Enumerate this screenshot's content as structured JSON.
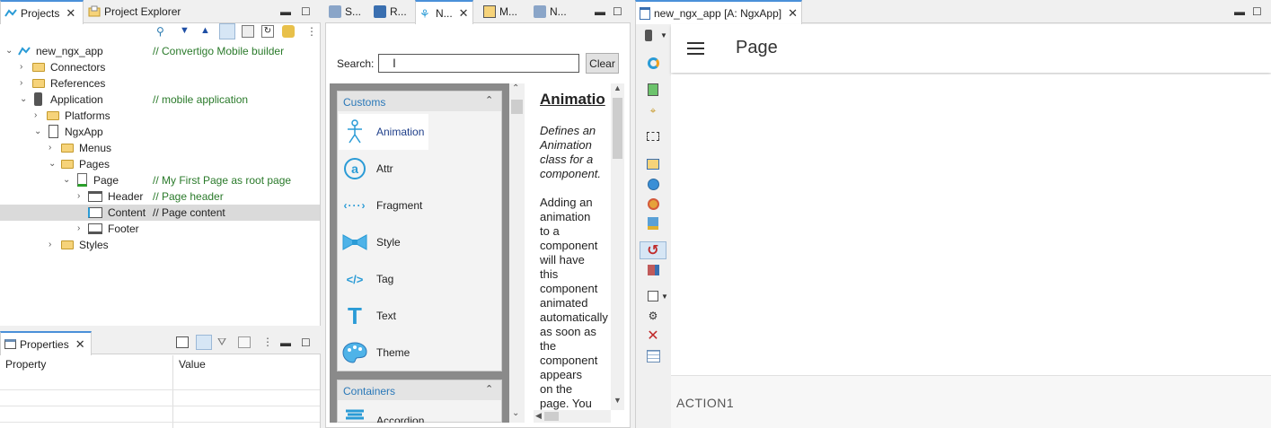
{
  "left_tabs": {
    "projects": "Projects",
    "project_explorer": "Project Explorer"
  },
  "tree": [
    {
      "label": "new_ngx_app",
      "comment": "// Convertigo Mobile builder"
    },
    {
      "label": "Connectors",
      "comment": ""
    },
    {
      "label": "References",
      "comment": ""
    },
    {
      "label": "Application",
      "comment": "// mobile application"
    },
    {
      "label": "Platforms",
      "comment": ""
    },
    {
      "label": "NgxApp",
      "comment": ""
    },
    {
      "label": "Menus",
      "comment": ""
    },
    {
      "label": "Pages",
      "comment": ""
    },
    {
      "label": "Page",
      "comment": "// My First Page as root page"
    },
    {
      "label": "Header",
      "comment": "// Page header"
    },
    {
      "label": "Content",
      "comment": "// Page content"
    },
    {
      "label": "Footer",
      "comment": ""
    },
    {
      "label": "Styles",
      "comment": ""
    }
  ],
  "properties": {
    "tab": "Properties",
    "col_property": "Property",
    "col_value": "Value"
  },
  "middle_tabs": [
    "S...",
    "R...",
    "N...",
    "M...",
    "N..."
  ],
  "search": {
    "label": "Search:",
    "value": "",
    "clear": "Clear"
  },
  "palette": {
    "customs_header": "Customs",
    "items": [
      "Animation",
      "Attr",
      "Fragment",
      "Style",
      "Tag",
      "Text",
      "Theme"
    ],
    "containers_header": "Containers",
    "containers_first": "Accordion"
  },
  "doc": {
    "title": "Animatio",
    "intro": [
      "Defines an",
      "Animation",
      "class for a",
      "component."
    ],
    "body": [
      "Adding an",
      "animation",
      "to a",
      "component",
      "will have",
      "this",
      "component",
      "animated",
      "automatically",
      "as soon as",
      "the",
      "component",
      "appears",
      "on the",
      "page. You"
    ]
  },
  "editor": {
    "tab": "new_ngx_app [A: NgxApp]",
    "page_title": "Page",
    "footer_action": "ACTION1"
  },
  "colors": {
    "accent": "#2a9bd6",
    "comment_green": "#2a7a2a",
    "selection": "#dadada"
  }
}
